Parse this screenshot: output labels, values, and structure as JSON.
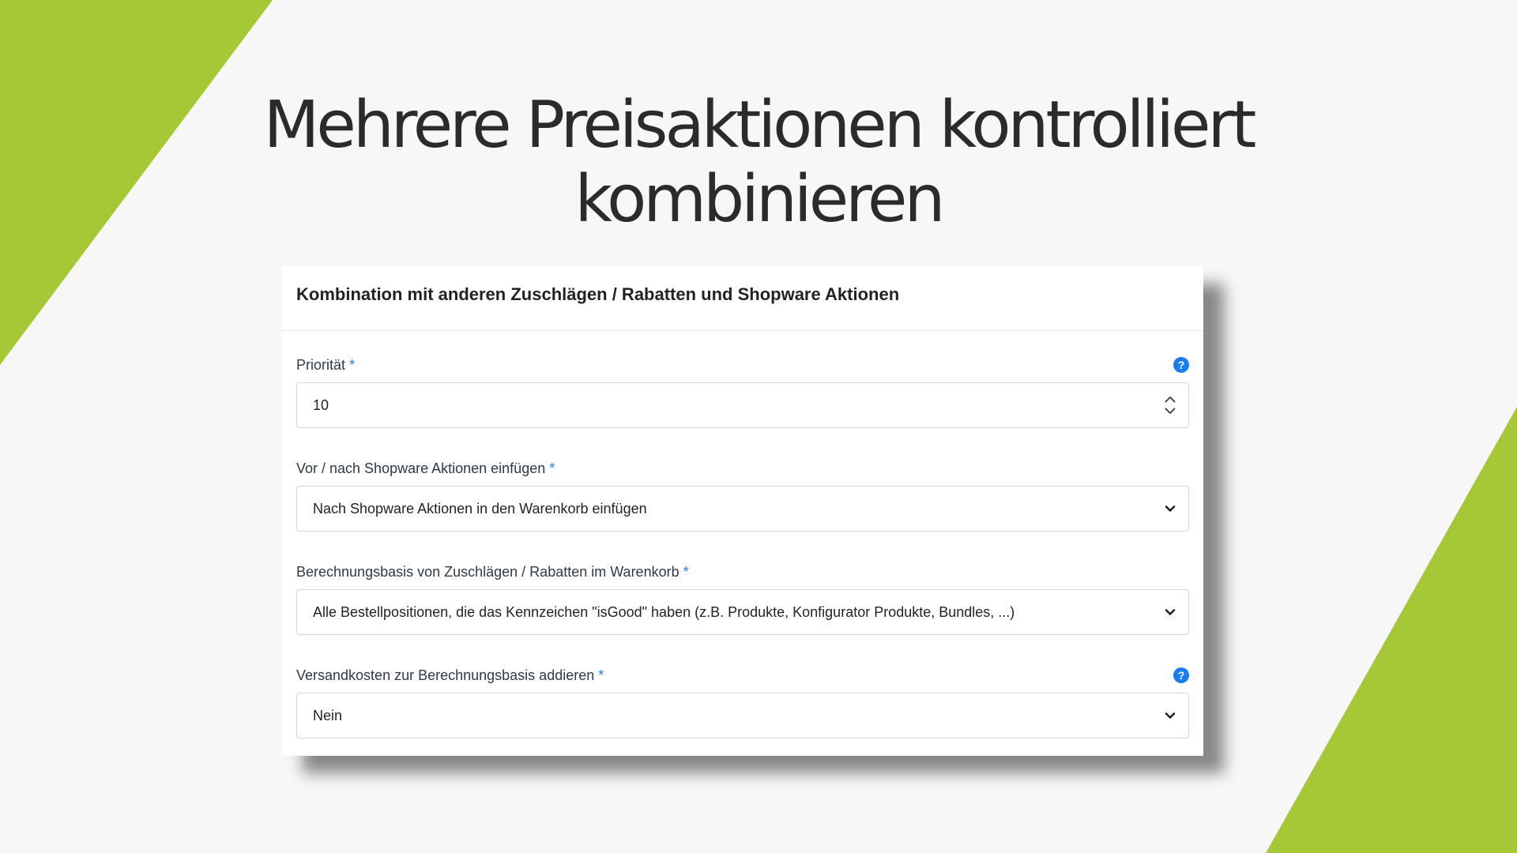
{
  "headline": {
    "line1": "Mehrere Preisaktionen kontrolliert",
    "line2": "kombinieren"
  },
  "colors": {
    "accent_green": "#a6c736",
    "help_blue": "#1a7cf0",
    "background": "#f7f7f7"
  },
  "card": {
    "title": "Kombination mit anderen Zuschlägen / Rabatten und Shopware Aktionen",
    "fields": [
      {
        "label": "Priorität",
        "required_mark": "*",
        "help_icon": "question-circle-icon",
        "help_glyph": "?",
        "type": "number",
        "value": "10"
      },
      {
        "label": "Vor / nach Shopware Aktionen einfügen",
        "required_mark": "*",
        "type": "select",
        "value": "Nach Shopware Aktionen in den Warenkorb einfügen"
      },
      {
        "label": "Berechnungsbasis von Zuschlägen / Rabatten im Warenkorb",
        "required_mark": "*",
        "type": "select",
        "value": "Alle Bestellpositionen, die das Kennzeichen \"isGood\" haben (z.B. Produkte, Konfigurator Produkte, Bundles, ...)"
      },
      {
        "label": "Versandkosten zur Berechnungsbasis addieren",
        "required_mark": "*",
        "help_icon": "question-circle-icon",
        "help_glyph": "?",
        "type": "select",
        "value": "Nein"
      }
    ]
  }
}
